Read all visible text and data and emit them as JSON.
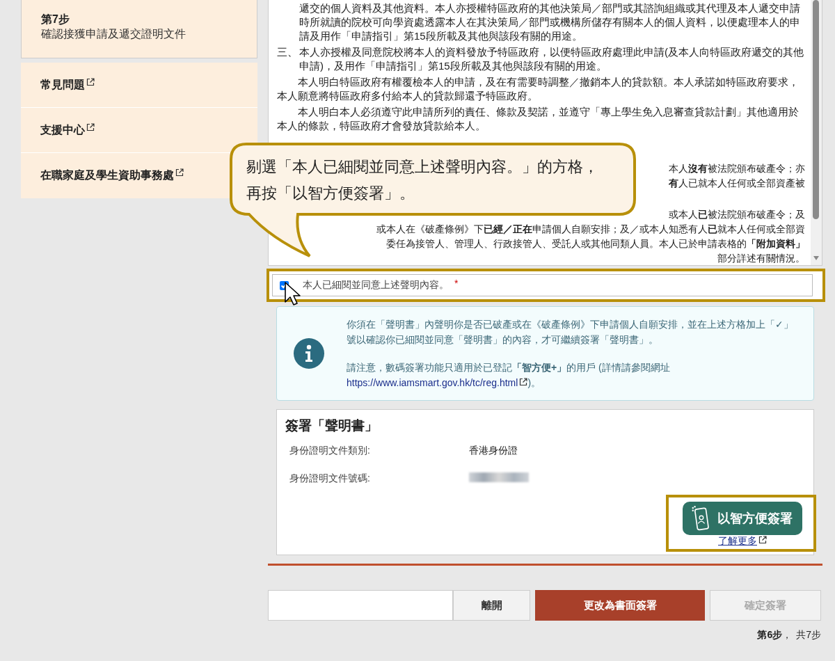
{
  "sidebar": {
    "step": {
      "number": "第7步",
      "title": "確認接獲申請及遞交證明文件"
    },
    "links": [
      {
        "label": "常見問題"
      },
      {
        "label": "支援中心"
      },
      {
        "label": "在職家庭及學生資助事務處"
      }
    ]
  },
  "declaration": {
    "paragraphs": [
      {
        "kind": "continued",
        "text": "遞交的個人資料及其他資料。本人亦授權特區政府的其他決策局／部門或其諮詢組織或其代理及本人遞交申請時所就讀的院校可向學資處透露本人在其決策局／部門或機構所儲存有關本人的個人資料，以便處理本人的申請及用作「申請指引」第15段所載及其他與該段有關的用途。"
      },
      {
        "kind": "item",
        "marker": "三、",
        "text": "本人亦授權及同意院校將本人的資料發放予特區政府，以便特區政府處理此申請(及本人向特區政府遞交的其他申請)，及用作「申請指引」第15段所載及其他與該段有關的用途。"
      },
      {
        "kind": "para",
        "text": "本人明白特區政府有權覆檢本人的申請，及在有需要時調整／撤銷本人的貸款額。本人承諾如特區政府要求，本人願意將特區政府多付給本人的貸款歸還予特區政府。"
      },
      {
        "kind": "para",
        "text": "本人明白本人必須遵守此申請所列的責任、條款及契諾，並遵守「專上學生免入息審查貸款計劃」其他適用於本人的條款，特區政府才會發放貸款給本人。"
      }
    ],
    "partial_groups": [
      [
        "本人**沒有**被法院頒布破產令；亦",
        "**有**人已就本人任何或全部資產被"
      ],
      [
        "或本人**已**被法院頒布破產令；及",
        "或本人在《破產條例》下**已經／正在**申請個人自願安排；及／或本人知悉有人**已**就本人任何或全部資",
        "委任為接管人、管理人、行政接管人、受託人或其他同類人員。本人已於申請表格的**「附加資料」**",
        "部分詳述有關情況。"
      ]
    ]
  },
  "callout": {
    "text": "剔選「本人已細閱並同意上述聲明內容。」的方格，再按「以智方便簽署」。"
  },
  "agree": {
    "label": "本人已細閱並同意上述聲明內容。",
    "required": "*",
    "checked": true
  },
  "info": {
    "notice": "你須在「聲明書」內聲明你是否已破產或在《破產條例》下申請個人自願安排，並在上述方格加上「✓」號以確認你已細閱並同意「聲明書」的內容，才可繼續簽署「聲明書」。",
    "note": "請注意，數碼簽署功能只適用於已登記**「智方便+」**的用戶 (詳情請參閱網址",
    "link": "https://www.iamsmart.gov.hk/tc/reg.html",
    "note_end": ")。"
  },
  "sign": {
    "title": "簽署「聲明書」",
    "fields": [
      {
        "label": "身份證明文件類別:",
        "value": "香港身份證",
        "kind": "text"
      },
      {
        "label": "身份證明文件號碼:",
        "kind": "blurred"
      }
    ],
    "iamsmart_button": "以智方便簽署",
    "learn_more": "了解更多"
  },
  "buttons": [
    {
      "label": "離開",
      "kind": "plain",
      "disabled": false
    },
    {
      "label": "更改為書面簽署",
      "kind": "primary",
      "disabled": false
    },
    {
      "label": "確定簽署",
      "kind": "plain",
      "disabled": true
    }
  ],
  "progress": {
    "current": "第6步",
    "sep": "，",
    "total": "共7步"
  }
}
